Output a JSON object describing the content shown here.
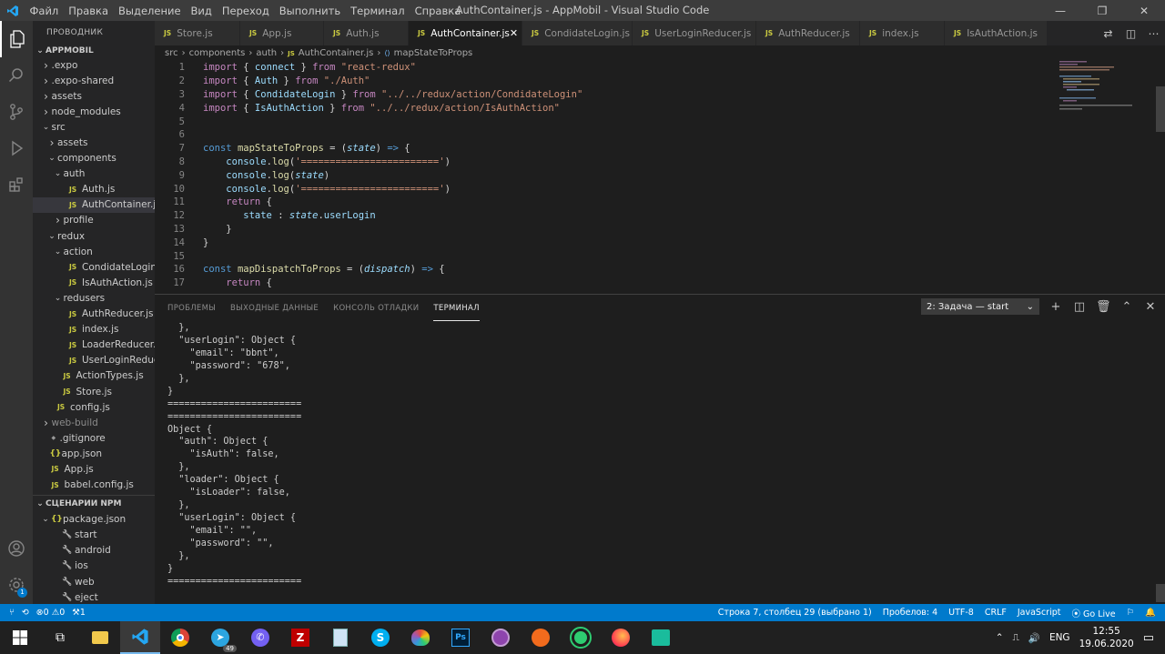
{
  "titlebar": {
    "menu": [
      "Файл",
      "Правка",
      "Выделение",
      "Вид",
      "Переход",
      "Выполнить",
      "Терминал",
      "Справка"
    ],
    "title": "AuthContainer.js - AppMobil - Visual Studio Code"
  },
  "sidebar": {
    "header": "ПРОВОДНИК",
    "project": "APPMOBIL",
    "tree": [
      {
        "label": ".expo",
        "depth": 1,
        "kind": "folder",
        "open": false
      },
      {
        "label": ".expo-shared",
        "depth": 1,
        "kind": "folder",
        "open": false
      },
      {
        "label": "assets",
        "depth": 1,
        "kind": "folder",
        "open": false
      },
      {
        "label": "node_modules",
        "depth": 1,
        "kind": "folder",
        "open": false
      },
      {
        "label": "src",
        "depth": 1,
        "kind": "folder",
        "open": true
      },
      {
        "label": "assets",
        "depth": 2,
        "kind": "folder",
        "open": false
      },
      {
        "label": "components",
        "depth": 2,
        "kind": "folder",
        "open": true
      },
      {
        "label": "auth",
        "depth": 3,
        "kind": "folder",
        "open": true
      },
      {
        "label": "Auth.js",
        "depth": 4,
        "kind": "js"
      },
      {
        "label": "AuthContainer.js",
        "depth": 4,
        "kind": "js",
        "selected": true
      },
      {
        "label": "profile",
        "depth": 3,
        "kind": "folder",
        "open": false
      },
      {
        "label": "redux",
        "depth": 2,
        "kind": "folder",
        "open": true
      },
      {
        "label": "action",
        "depth": 3,
        "kind": "folder",
        "open": true
      },
      {
        "label": "CondidateLogin.js",
        "depth": 4,
        "kind": "js"
      },
      {
        "label": "IsAuthAction.js",
        "depth": 4,
        "kind": "js"
      },
      {
        "label": "redusers",
        "depth": 3,
        "kind": "folder",
        "open": true
      },
      {
        "label": "AuthReducer.js",
        "depth": 4,
        "kind": "js"
      },
      {
        "label": "index.js",
        "depth": 4,
        "kind": "js"
      },
      {
        "label": "LoaderReducer.js",
        "depth": 4,
        "kind": "js"
      },
      {
        "label": "UserLoginReduce...",
        "depth": 4,
        "kind": "js"
      },
      {
        "label": "ActionTypes.js",
        "depth": 3,
        "kind": "js"
      },
      {
        "label": "Store.js",
        "depth": 3,
        "kind": "js"
      },
      {
        "label": "config.js",
        "depth": 2,
        "kind": "js"
      },
      {
        "label": "web-build",
        "depth": 1,
        "kind": "folder",
        "open": false,
        "dim": true
      },
      {
        "label": ".gitignore",
        "depth": 1,
        "kind": "dot"
      },
      {
        "label": "app.json",
        "depth": 1,
        "kind": "json"
      },
      {
        "label": "App.js",
        "depth": 1,
        "kind": "js"
      },
      {
        "label": "babel.config.js",
        "depth": 1,
        "kind": "js"
      }
    ],
    "npm_header": "СЦЕНАРИИ NPM",
    "npm_package": "package.json",
    "npm_scripts": [
      "start",
      "android",
      "ios",
      "web",
      "eject"
    ]
  },
  "tabs": [
    {
      "label": "Store.js",
      "active": false
    },
    {
      "label": "App.js",
      "active": false
    },
    {
      "label": "Auth.js",
      "active": false
    },
    {
      "label": "AuthContainer.js",
      "active": true
    },
    {
      "label": "CondidateLogin.js",
      "active": false
    },
    {
      "label": "UserLoginReducer.js",
      "active": false
    },
    {
      "label": "AuthReducer.js",
      "active": false
    },
    {
      "label": "index.js",
      "active": false
    },
    {
      "label": "IsAuthAction.js",
      "active": false
    }
  ],
  "breadcrumb": [
    "src",
    "components",
    "auth",
    "AuthContainer.js",
    "mapStateToProps"
  ],
  "code": [
    {
      "n": "1",
      "t": [
        [
          "kw",
          "import "
        ],
        [
          "d",
          "{ "
        ],
        [
          "vr",
          "connect"
        ],
        [
          "d",
          " } "
        ],
        [
          "kw",
          "from "
        ],
        [
          "st",
          "\"react-redux\""
        ]
      ]
    },
    {
      "n": "2",
      "t": [
        [
          "kw",
          "import "
        ],
        [
          "d",
          "{ "
        ],
        [
          "vr",
          "Auth"
        ],
        [
          "d",
          " } "
        ],
        [
          "kw",
          "from "
        ],
        [
          "st",
          "\"./Auth\""
        ]
      ]
    },
    {
      "n": "3",
      "t": [
        [
          "kw",
          "import "
        ],
        [
          "d",
          "{ "
        ],
        [
          "vr",
          "CondidateLogin"
        ],
        [
          "d",
          " } "
        ],
        [
          "kw",
          "from "
        ],
        [
          "st",
          "\"../../redux/action/CondidateLogin\""
        ]
      ]
    },
    {
      "n": "4",
      "t": [
        [
          "kw",
          "import "
        ],
        [
          "d",
          "{ "
        ],
        [
          "vr",
          "IsAuthAction"
        ],
        [
          "d",
          " } "
        ],
        [
          "kw",
          "from "
        ],
        [
          "st",
          "\"../../redux/action/IsAuthAction\""
        ]
      ]
    },
    {
      "n": "5",
      "t": []
    },
    {
      "n": "6",
      "t": []
    },
    {
      "n": "7",
      "t": [
        [
          "kb",
          "const "
        ],
        [
          "fn",
          "mapStateToProps"
        ],
        [
          "d",
          " = ("
        ],
        [
          "pm",
          "state"
        ],
        [
          "d",
          ") "
        ],
        [
          "kb",
          "=>"
        ],
        [
          "d",
          " {"
        ]
      ]
    },
    {
      "n": "8",
      "t": [
        [
          "d",
          "    "
        ],
        [
          "vr",
          "console"
        ],
        [
          "d",
          "."
        ],
        [
          "fn",
          "log"
        ],
        [
          "d",
          "("
        ],
        [
          "st",
          "'========================'"
        ],
        [
          "d",
          ")"
        ]
      ]
    },
    {
      "n": "9",
      "t": [
        [
          "d",
          "    "
        ],
        [
          "vr",
          "console"
        ],
        [
          "d",
          "."
        ],
        [
          "fn",
          "log"
        ],
        [
          "d",
          "("
        ],
        [
          "pm",
          "state"
        ],
        [
          "d",
          ")"
        ]
      ]
    },
    {
      "n": "10",
      "t": [
        [
          "d",
          "    "
        ],
        [
          "vr",
          "console"
        ],
        [
          "d",
          "."
        ],
        [
          "fn",
          "log"
        ],
        [
          "d",
          "("
        ],
        [
          "st",
          "'========================'"
        ],
        [
          "d",
          ")"
        ]
      ]
    },
    {
      "n": "11",
      "t": [
        [
          "d",
          "    "
        ],
        [
          "kw",
          "return"
        ],
        [
          "d",
          " {"
        ]
      ]
    },
    {
      "n": "12",
      "t": [
        [
          "d",
          "       "
        ],
        [
          "vr",
          "state"
        ],
        [
          "d",
          " : "
        ],
        [
          "pm",
          "state"
        ],
        [
          "d",
          "."
        ],
        [
          "vr",
          "userLogin"
        ]
      ]
    },
    {
      "n": "13",
      "t": [
        [
          "d",
          "    }"
        ]
      ]
    },
    {
      "n": "14",
      "t": [
        [
          "d",
          "}"
        ]
      ]
    },
    {
      "n": "15",
      "t": []
    },
    {
      "n": "16",
      "t": [
        [
          "kb",
          "const "
        ],
        [
          "fn",
          "mapDispatchToProps"
        ],
        [
          "d",
          " = ("
        ],
        [
          "pm",
          "dispatch"
        ],
        [
          "d",
          ") "
        ],
        [
          "kb",
          "=>"
        ],
        [
          "d",
          " {"
        ]
      ]
    },
    {
      "n": "17",
      "t": [
        [
          "d",
          "    "
        ],
        [
          "kw",
          "return"
        ],
        [
          "d",
          " {"
        ]
      ]
    }
  ],
  "panel": {
    "tabs": [
      {
        "label": "ПРОБЛЕМЫ",
        "active": false
      },
      {
        "label": "ВЫХОДНЫЕ ДАННЫЕ",
        "active": false
      },
      {
        "label": "КОНСОЛЬ ОТЛАДКИ",
        "active": false
      },
      {
        "label": "ТЕРМИНАЛ",
        "active": true
      }
    ],
    "task_select": "2: Задача — start"
  },
  "terminal": [
    "  },",
    "  \"userLogin\": Object {",
    "    \"email\": \"bbnt\",",
    "    \"password\": \"678\",",
    "  },",
    "}",
    "========================",
    "========================",
    "Object {",
    "  \"auth\": Object {",
    "    \"isAuth\": false,",
    "  },",
    "  \"loader\": Object {",
    "    \"isLoader\": false,",
    "  },",
    "  \"userLogin\": Object {",
    "    \"email\": \"\",",
    "    \"password\": \"\",",
    "  },",
    "}",
    "========================"
  ],
  "statusbar": {
    "errors": "0",
    "warnings": "0",
    "sync": "1",
    "position": "Строка 7, столбец 29 (выбрано 1)",
    "spaces": "Пробелов: 4",
    "encoding": "UTF-8",
    "eol": "CRLF",
    "language": "JavaScript",
    "golive": "Go Live"
  },
  "taskbar": {
    "apps": [
      "file-explorer",
      "vscode",
      "chrome",
      "telegram",
      "viber",
      "filezilla",
      "notepad",
      "skype",
      "paint",
      "photoshop",
      "app-purple",
      "app-orange",
      "app-green",
      "firefox",
      "app-teal"
    ],
    "telegram_badge": "49",
    "lang": "ENG",
    "time": "12:55",
    "date": "19.06.2020"
  },
  "colors": {
    "accent": "#007acc",
    "activity_bar": "#333333",
    "sidebar": "#252526",
    "editor": "#1e1e1e"
  }
}
